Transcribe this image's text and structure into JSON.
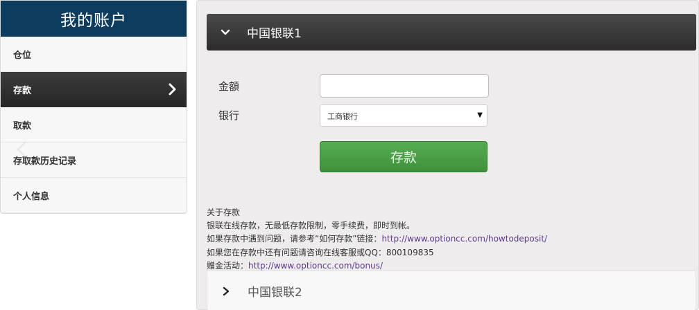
{
  "sidebar": {
    "title": "我的账户",
    "items": [
      {
        "label": "仓位"
      },
      {
        "label": "存款"
      },
      {
        "label": "取款"
      },
      {
        "label": "存取款历史记录"
      },
      {
        "label": "个人信息"
      }
    ],
    "active_index": 1
  },
  "accordion": {
    "section1_title": "中国银联1",
    "section2_title": "中国银联2"
  },
  "form": {
    "amount_label": "金額",
    "amount_value": "",
    "bank_label": "银行",
    "bank_selected": "工商银行",
    "submit_label": "存款"
  },
  "info": {
    "heading": "关于存款",
    "line1": "银联在线存款，无最低存款限制，零手续费，即时到帐。",
    "line2_prefix": "如果存款中遇到问题，请参考“如何存款”链接：",
    "line2_link": "http://www.optioncc.com/howtodeposit/",
    "line3": "如果您在存款中还有问题请咨询在线客服或QQ：800109835",
    "line4_prefix": "赠金活动：",
    "line4_link": "http://www.optioncc.com/bonus/"
  },
  "colors": {
    "sidebar_title_bg": "#0e3c5f",
    "active_item_bg": "#2e2e2e",
    "button_green": "#4a9f46",
    "link_color": "#5a3a8a"
  },
  "icons": {
    "nav_active": "chevron-right-icon",
    "accordion_open": "chevron-down-icon",
    "accordion_closed": "chevron-right-icon",
    "select": "caret-down-icon"
  }
}
